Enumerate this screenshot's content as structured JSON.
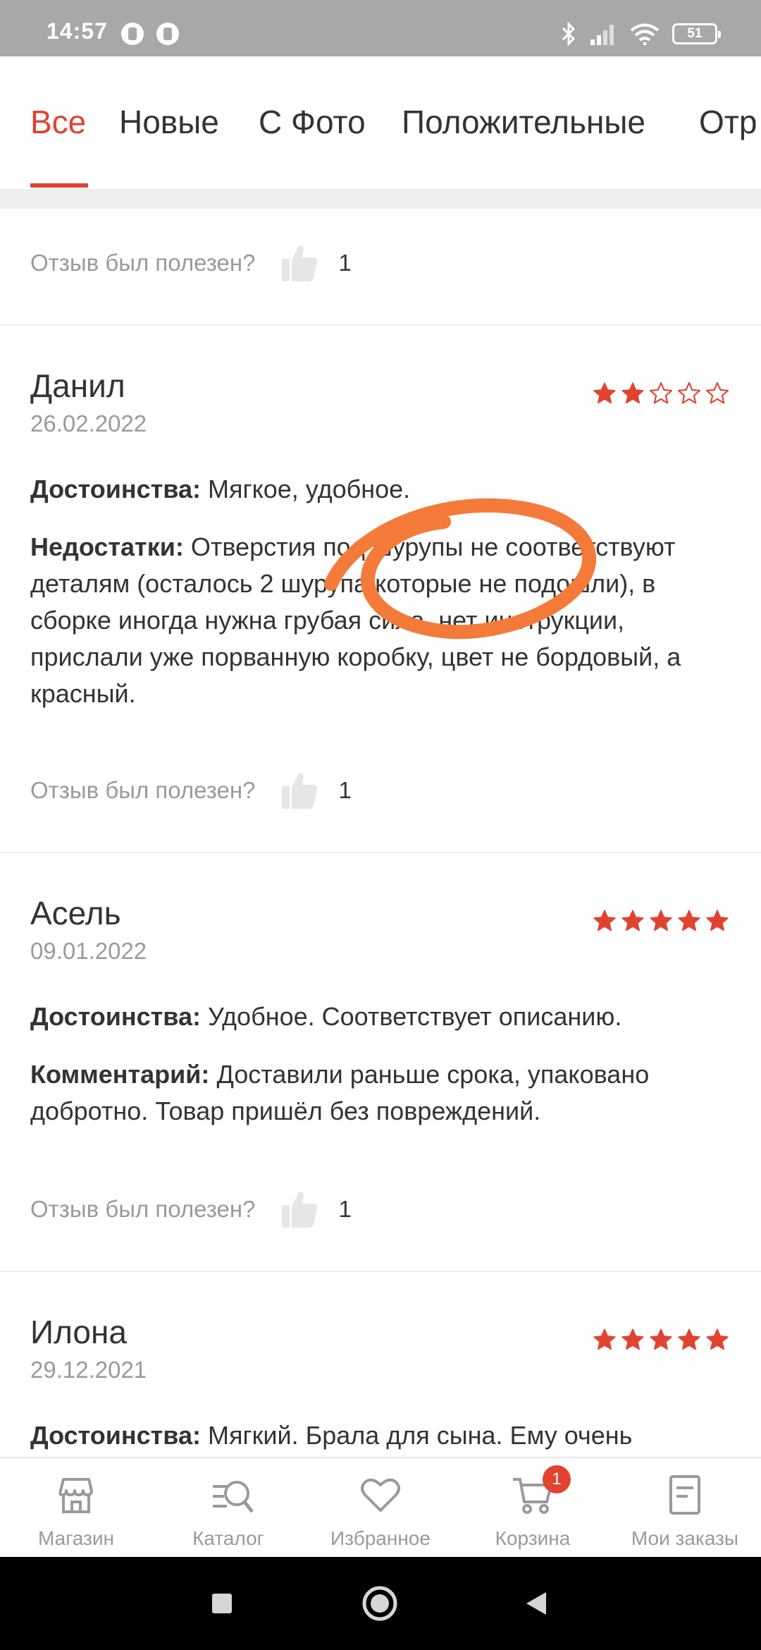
{
  "status_bar": {
    "time": "14:57",
    "battery": "51"
  },
  "tabs": [
    {
      "label": "Все",
      "active": true
    },
    {
      "label": "Новые",
      "active": false
    },
    {
      "label": "С Фото",
      "active": false
    },
    {
      "label": "Положительные",
      "active": false
    },
    {
      "label": "Отр",
      "active": false
    }
  ],
  "helpful_label": "Отзыв был полезен?",
  "first_helpful_count": "1",
  "reviews": [
    {
      "author": "Данил",
      "date": "26.02.2022",
      "rating": 2,
      "pros_label": "Достоинства:",
      "pros": "Мягкое, удобное.",
      "cons_label": "Недостатки:",
      "cons": "Отверстия под шурупы не соответствуют деталям (осталось 2 шурупа которые не подошли), в сборке иногда нужна грубая сила, нет инструкции, прислали уже порванную коробку, цвет не бордовый, а красный.",
      "helpful_count": "1"
    },
    {
      "author": "Асель",
      "date": "09.01.2022",
      "rating": 5,
      "pros_label": "Достоинства:",
      "pros": "Удобное. Соответствует описанию.",
      "comment_label": "Комментарий:",
      "comment": "Доставили раньше срока, упаковано добротно. Товар пришёл без повреждений.",
      "helpful_count": "1"
    },
    {
      "author": "Илона",
      "date": "29.12.2021",
      "rating": 5,
      "pros_label": "Достоинства:",
      "pros": "Мягкий. Брала для сына. Ему очень"
    }
  ],
  "bottom_nav": [
    {
      "label": "Магазин",
      "icon": "store-icon"
    },
    {
      "label": "Каталог",
      "icon": "catalog-search-icon"
    },
    {
      "label": "Избранное",
      "icon": "heart-icon"
    },
    {
      "label": "Корзина",
      "icon": "cart-icon",
      "badge": "1"
    },
    {
      "label": "Мои заказы",
      "icon": "orders-icon"
    }
  ],
  "colors": {
    "accent": "#e0432f",
    "annotation": "#f47a3a",
    "muted": "#9a9a9a"
  }
}
